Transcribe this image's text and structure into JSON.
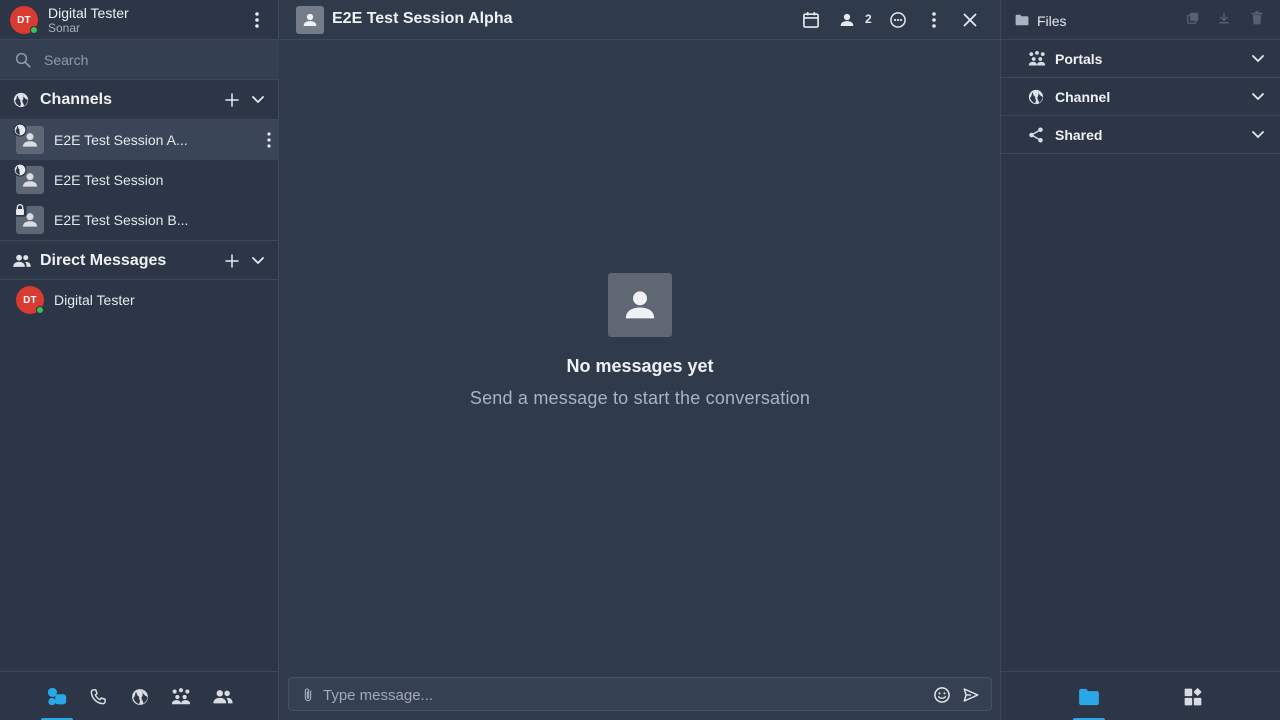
{
  "colors": {
    "accent": "#2aa7e6",
    "avatar_red": "#d93a31",
    "presence_online": "#3fbf4f",
    "background": "#2f3a4b",
    "sidebar": "#2c3646"
  },
  "user": {
    "initials": "DT",
    "name": "Digital Tester",
    "subtitle": "Sonar",
    "status": "online",
    "menu_icon": "more-vertical-icon"
  },
  "search": {
    "placeholder": "Search",
    "value": ""
  },
  "channels": {
    "title": "Channels",
    "icon": "globe-icon",
    "items": [
      {
        "label": "E2E Test Session A...",
        "badge_icon": "globe-icon",
        "active": true
      },
      {
        "label": "E2E Test Session",
        "badge_icon": "globe-icon",
        "active": false
      },
      {
        "label": "E2E Test Session B...",
        "badge_icon": "lock-icon",
        "active": false
      }
    ]
  },
  "direct_messages": {
    "title": "Direct Messages",
    "icon": "people-icon",
    "items": [
      {
        "initials": "DT",
        "label": "Digital Tester",
        "status": "online"
      }
    ]
  },
  "bottom_nav": [
    {
      "name": "chats",
      "icon": "chat-bubbles-icon",
      "active": true
    },
    {
      "name": "calls",
      "icon": "phone-icon",
      "active": false
    },
    {
      "name": "globe",
      "icon": "globe-icon",
      "active": false
    },
    {
      "name": "portals",
      "icon": "portals-icon",
      "active": false
    },
    {
      "name": "contacts",
      "icon": "people-icon",
      "active": false
    }
  ],
  "conversation": {
    "title": "E2E Test Session Alpha",
    "member_count": "2",
    "empty_title": "No messages yet",
    "empty_subtitle": "Send a message to start the conversation"
  },
  "composer": {
    "placeholder": "Type message...",
    "value": ""
  },
  "files_panel": {
    "title": "Files",
    "sections": [
      {
        "label": "Portals",
        "icon": "portals-icon"
      },
      {
        "label": "Channel",
        "icon": "globe-icon"
      },
      {
        "label": "Shared",
        "icon": "share-icon"
      }
    ],
    "tabs": [
      {
        "name": "files",
        "icon": "folder-icon",
        "active": true
      },
      {
        "name": "apps",
        "icon": "apps-icon",
        "active": false
      }
    ]
  }
}
